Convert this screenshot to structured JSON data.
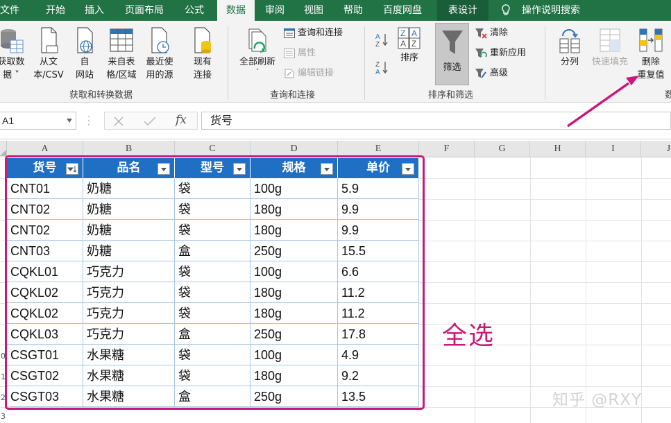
{
  "tabs": [
    "文件",
    "开始",
    "插入",
    "页面布局",
    "公式",
    "数据",
    "审阅",
    "视图",
    "帮助",
    "百度网盘",
    "表设计",
    "操作说明搜索"
  ],
  "ribbon": {
    "get_transform": {
      "get_data": "获取数\n据 ˅",
      "from_csv": "从文\n本/CSV",
      "from_web": "自\n网站",
      "from_table": "来自表\n格/区域",
      "recent_sources": "最近使\n用的源",
      "existing_conn": "现有\n连接",
      "label": "获取和转换数据"
    },
    "queries": {
      "refresh_all": "全部刷新",
      "queries_conn": "查询和连接",
      "properties": "属性",
      "edit_links": "编辑链接",
      "label": "查询和连接"
    },
    "sort_filter": {
      "sort": "排序",
      "filter": "筛选",
      "clear": "清除",
      "reapply": "重新应用",
      "advanced": "高级",
      "label": "排序和筛选"
    },
    "data_tools": {
      "text_to_columns": "分列",
      "flash_fill": "快速填充",
      "remove_dup": "删除\n重复值",
      "label": "数"
    }
  },
  "formula_bar": {
    "name_box": "A1",
    "fx": "fx",
    "content": "货号"
  },
  "columns": [
    "A",
    "B",
    "C",
    "D",
    "E",
    "F",
    "G",
    "H",
    "I",
    "J"
  ],
  "row_numbers": [
    "0",
    "1",
    "2",
    "3"
  ],
  "table": {
    "headers": [
      "货号",
      "品名",
      "型号",
      "规格",
      "单价"
    ],
    "rows": [
      [
        "CNT01",
        "奶糖",
        "袋",
        "100g",
        "5.9"
      ],
      [
        "CNT02",
        "奶糖",
        "袋",
        "180g",
        "9.9"
      ],
      [
        "CNT02",
        "奶糖",
        "袋",
        "180g",
        "9.9"
      ],
      [
        "CNT03",
        "奶糖",
        "盒",
        "250g",
        "15.5"
      ],
      [
        "CQKL01",
        "巧克力",
        "袋",
        "100g",
        "6.6"
      ],
      [
        "CQKL02",
        "巧克力",
        "袋",
        "180g",
        "11.2"
      ],
      [
        "CQKL02",
        "巧克力",
        "袋",
        "180g",
        "11.2"
      ],
      [
        "CQKL03",
        "巧克力",
        "盒",
        "250g",
        "17.8"
      ],
      [
        "CSGT01",
        "水果糖",
        "袋",
        "100g",
        "4.9"
      ],
      [
        "CSGT02",
        "水果糖",
        "袋",
        "180g",
        "9.2"
      ],
      [
        "CSGT03",
        "水果糖",
        "盒",
        "250g",
        "13.5"
      ]
    ]
  },
  "annotation": "全选",
  "watermark": "知乎 @RXY",
  "colors": {
    "ribbon_green": "#217346",
    "table_header_blue": "#1f6fc5",
    "annotation_magenta": "#c8187a"
  }
}
